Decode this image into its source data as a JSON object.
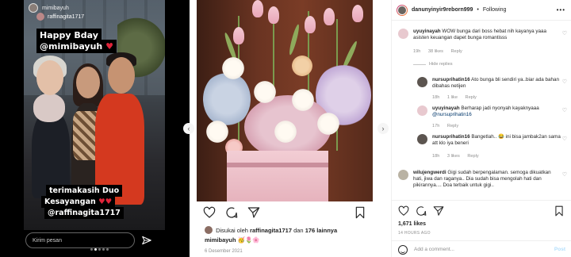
{
  "story": {
    "username": "mimibayuh",
    "top_mention": "raffinagita1717",
    "sticker_bday": "Happy Bday",
    "sticker_mimi": "@mimibayuh",
    "thanks_line1": "terimakasih Duo",
    "thanks_line2": "Kesayangan",
    "thanks_line3": "@raffinagita1717",
    "reply_placeholder": "Kirim pesan"
  },
  "post": {
    "liked_by_prefix": "Disukai oleh",
    "liked_by_user": "raffinagita1717",
    "liked_by_and": "dan",
    "liked_by_others": "176 lainnya",
    "caption_user": "mimibayuh",
    "caption_emoji": "🥳🌷🌸",
    "date": "6 Desember 2021"
  },
  "comments_panel": {
    "owner": "danunyinyir9reborn999",
    "follow_label": "Following",
    "comments": [
      {
        "user": "uyuyinayah",
        "text": "WOW bunga dari boss hebat nih kayanya yaaa asisten keuangan dapet bunga romantisss",
        "time": "19h",
        "likes": "38 likes",
        "reply": "Reply"
      },
      {
        "user": "nursuprihatin16",
        "text": "Ato bunga bli sendiri ya..biar ada bahan dibahas netijen",
        "time": "18h",
        "likes": "1 like",
        "reply": "Reply"
      },
      {
        "user": "uyuyinayah",
        "text": "Berharap jadi nyonyah kayaknyaaa",
        "mention": "@nursuprihatin16",
        "time": "17h",
        "reply": "Reply"
      },
      {
        "user": "nursuprihatin16",
        "text": "Bangetlah.. 😂 ini bisa jambak2an sama att klo iya beneri",
        "time": "18h",
        "likes": "3 likes",
        "reply": "Reply"
      },
      {
        "user": "wilujengwerdi",
        "text": "Gigi sudah berpengalaman. semoga dikuatkan hati, jiwa dan raganya.. Dia sudah bisa mengolah hati dan pikirannya.... Doa terbaik untuk gigi..",
        "time": "",
        "reply": ""
      }
    ],
    "hide_replies": "Hide replies",
    "likes_total": "1,671 likes",
    "time_ago": "14 HOURS AGO",
    "add_comment_placeholder": "Add a comment...",
    "post_button": "Post"
  },
  "colors": {
    "story_bg": "#000000",
    "heart_red": "#e0243a",
    "link_blue": "#00376b",
    "muted_gray": "#8e8e8e",
    "post_button": "#b2dffc"
  },
  "icons": [
    "send-icon",
    "heart-icon",
    "comment-icon",
    "share-icon",
    "bookmark-icon",
    "more-icon",
    "emoji-icon",
    "chevron-left-icon",
    "chevron-right-icon"
  ]
}
